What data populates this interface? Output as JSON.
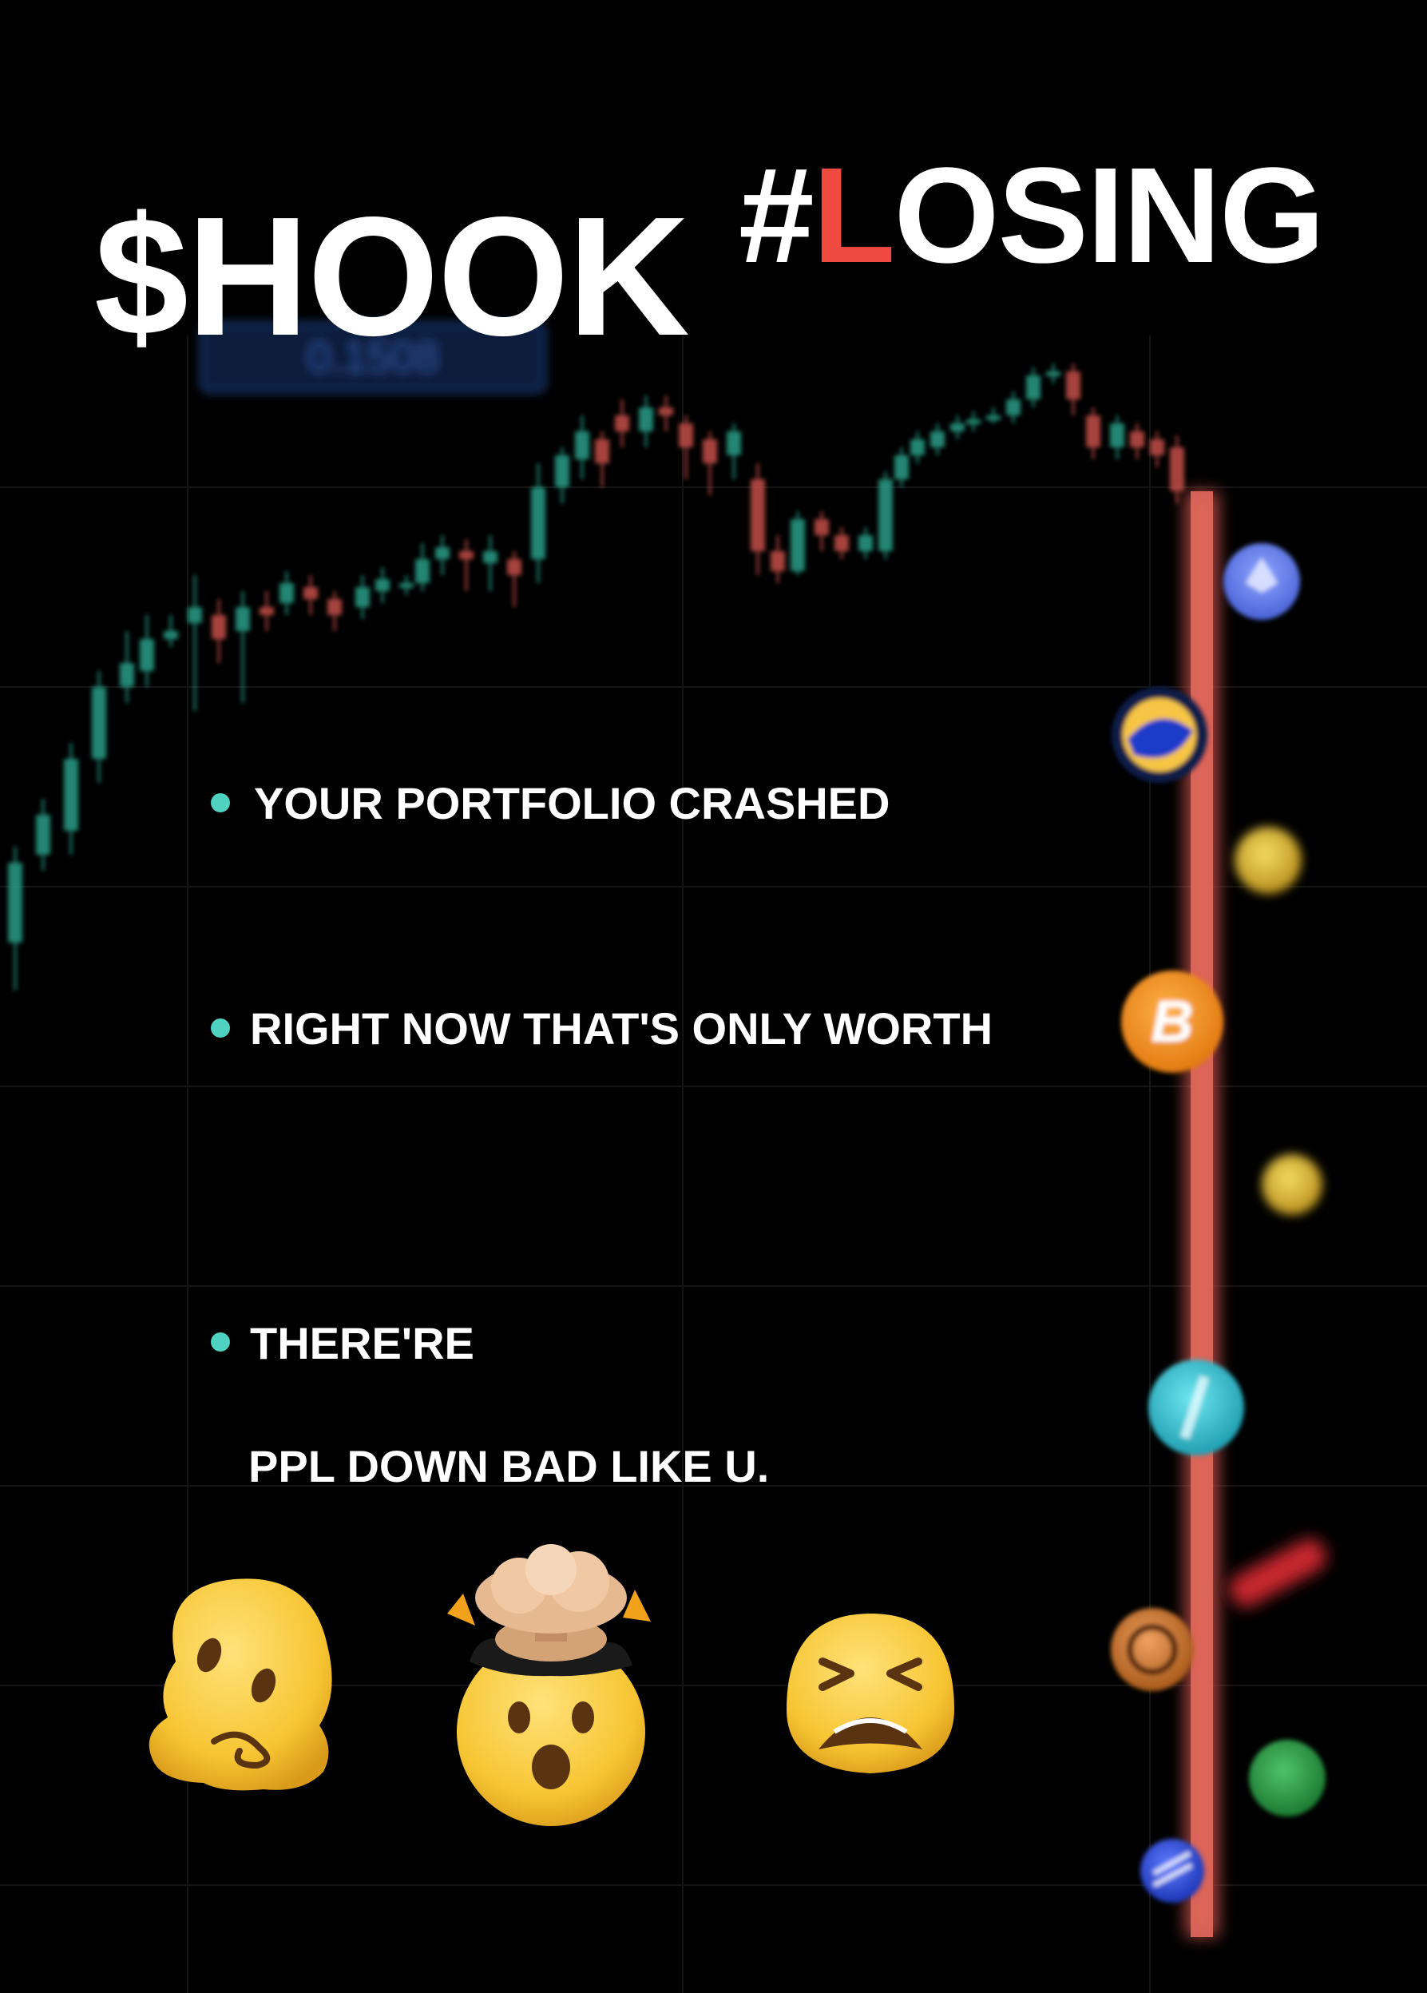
{
  "headline": {
    "left": "$HOOK",
    "right_prefix": "#",
    "right_accent": "L",
    "right_rest": "OSING"
  },
  "bullets": [
    {
      "text": "YOUR PORTFOLIO CRASHED"
    },
    {
      "text": "RIGHT NOW THAT'S ONLY WORTH"
    },
    {
      "text": "THERE'RE"
    }
  ],
  "bullet_continuation": "PPL DOWN BAD LIKE U.",
  "background_chart": {
    "price_tag": "0.1508"
  },
  "colors": {
    "background": "#000000",
    "text": "#ffffff",
    "accent_red": "#ef4a40",
    "bullet_teal": "#4fd2bf",
    "candle_up": "#2a9d88",
    "candle_down": "#c4504a"
  },
  "icons": [
    "melting-face-emoji-icon",
    "exploding-head-emoji-icon",
    "tired-face-emoji-icon",
    "ethereum-coin-icon",
    "terra-luna-coin-icon",
    "gold-coin-icon",
    "bitcoin-coin-icon",
    "teal-coin-icon",
    "orange-coin-icon",
    "green-coin-icon",
    "blue-coin-icon"
  ]
}
